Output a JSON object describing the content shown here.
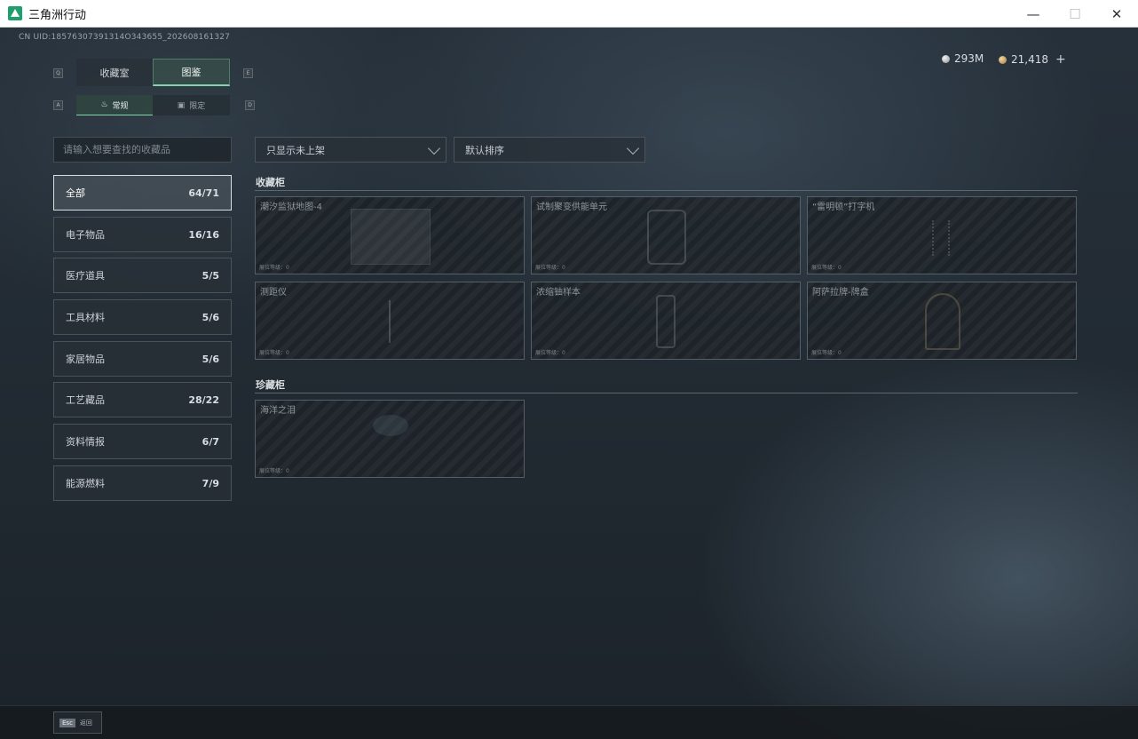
{
  "window": {
    "title": "三角洲行动",
    "minimize": "—",
    "maximize": "☐",
    "close": "✕"
  },
  "header": {
    "uid": "CN UID:18576307391314O343655_202608161327",
    "currency": [
      {
        "icon": "silver-coin-icon",
        "value": "293M"
      },
      {
        "icon": "gold-coin-icon",
        "value": "21,418"
      }
    ],
    "add_label": "+"
  },
  "tabs": {
    "left_key": "Q",
    "right_key": "E",
    "items": [
      {
        "label": "收藏室",
        "active": false
      },
      {
        "label": "图鉴",
        "active": true
      }
    ]
  },
  "subtabs": {
    "left_key": "A",
    "right_key": "D",
    "items": [
      {
        "label": "常规",
        "icon": "flame-icon",
        "active": true
      },
      {
        "label": "限定",
        "icon": "box-icon",
        "active": false
      }
    ]
  },
  "search": {
    "placeholder": "请输入想要查找的收藏品"
  },
  "categories": [
    {
      "label": "全部",
      "count": "64/71",
      "active": true
    },
    {
      "label": "电子物品",
      "count": "16/16"
    },
    {
      "label": "医疗道具",
      "count": "5/5"
    },
    {
      "label": "工具材料",
      "count": "5/6"
    },
    {
      "label": "家居物品",
      "count": "5/6"
    },
    {
      "label": "工艺藏品",
      "count": "28/22"
    },
    {
      "label": "资料情报",
      "count": "6/7"
    },
    {
      "label": "能源燃料",
      "count": "7/9"
    }
  ],
  "filters": {
    "filter_value": "只显示未上架",
    "sort_value": "默认排序"
  },
  "sections": [
    {
      "title": "收藏柜",
      "items": [
        {
          "name": "潮汐监狱地图-4",
          "level": "展位等级：0"
        },
        {
          "name": "试制聚变供能单元",
          "level": "展位等级：0"
        },
        {
          "name": "“雷明顿”打字机",
          "level": "展位等级：0"
        },
        {
          "name": "测距仪",
          "level": "展位等级：0"
        },
        {
          "name": "浓缩铀样本",
          "level": "展位等级：0"
        },
        {
          "name": "阿萨拉牌-牌盒",
          "level": "展位等级：0"
        }
      ]
    },
    {
      "title": "珍藏柜",
      "items": [
        {
          "name": "海洋之泪",
          "level": "展位等级：0"
        }
      ]
    }
  ],
  "footer": {
    "esc_key": "Esc",
    "back_label": "返回"
  }
}
